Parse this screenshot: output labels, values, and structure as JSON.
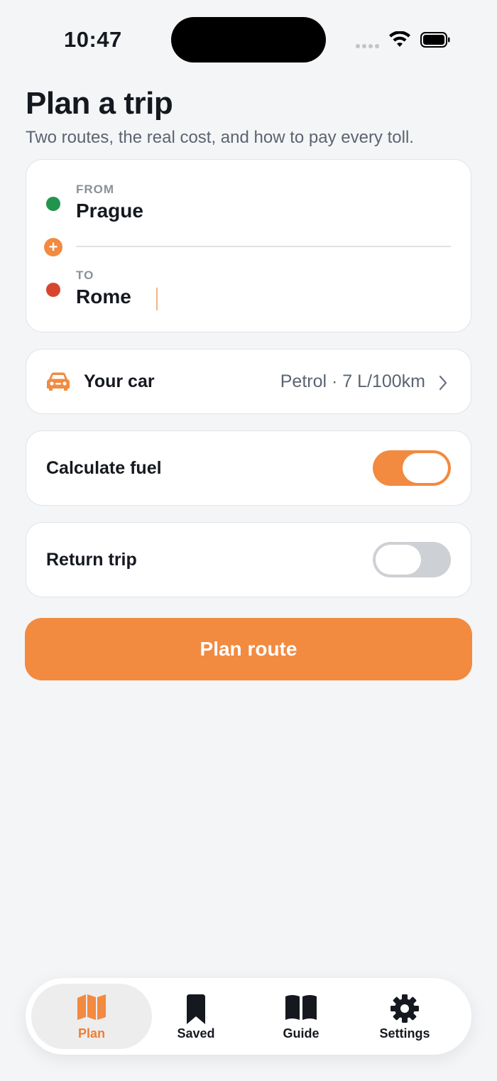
{
  "status_bar": {
    "time": "10:47",
    "icons": [
      "cellular-signal-icon",
      "wifi-icon",
      "battery-icon"
    ]
  },
  "header": {
    "title": "Plan a trip",
    "subtitle": "Two routes, the real cost, and how to pay every toll."
  },
  "route": {
    "from_label": "FROM",
    "from_value": "Prague",
    "to_label": "TO",
    "to_value": "Rome",
    "add_stop_glyph": "+"
  },
  "car": {
    "label": "Your car",
    "value": "Petrol · 7 L/100km",
    "icon": "car-icon"
  },
  "options": {
    "fuel_label": "Calculate fuel",
    "fuel_on": true,
    "return_label": "Return trip",
    "return_on": false
  },
  "primary_action": {
    "label": "Plan route"
  },
  "tabs": [
    {
      "label": "Plan",
      "icon": "map-icon",
      "active": true
    },
    {
      "label": "Saved",
      "icon": "bookmark-icon",
      "active": false
    },
    {
      "label": "Guide",
      "icon": "book-icon",
      "active": false
    },
    {
      "label": "Settings",
      "icon": "gear-icon",
      "active": false
    }
  ],
  "colors": {
    "accent": "#f28a40",
    "from_dot": "#21944e",
    "to_dot": "#d8452f",
    "background": "#f4f5f7"
  }
}
